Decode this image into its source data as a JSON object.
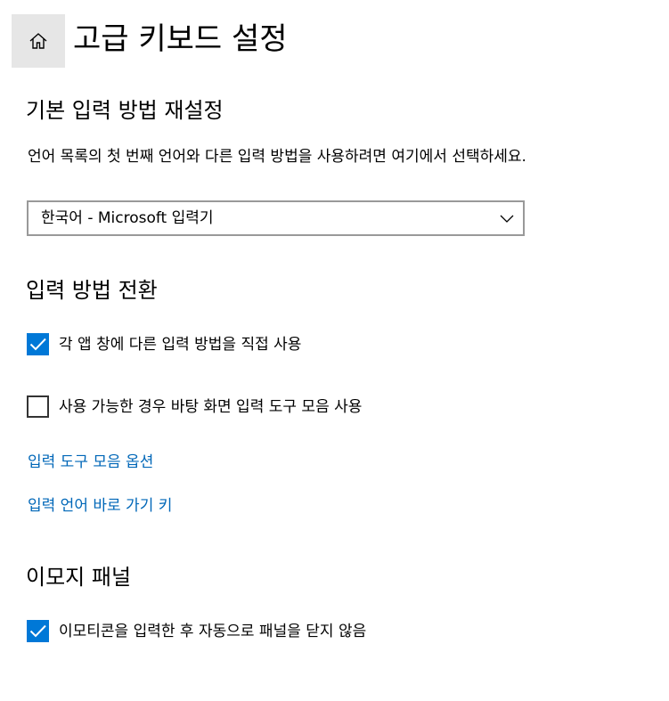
{
  "header": {
    "home_icon": "home-icon",
    "title": "고급 키보드 설정"
  },
  "default_input": {
    "title": "기본 입력 방법 재설정",
    "description": "언어 목록의 첫 번째 언어와 다른 입력 방법을 사용하려면 여기에서 선택하세요.",
    "dropdown_value": "한국어 - Microsoft 입력기",
    "dropdown_icon": "chevron-down-icon"
  },
  "input_switch": {
    "title": "입력 방법 전환",
    "checkbox_per_app": {
      "label": "각 앱 창에 다른 입력 방법을 직접 사용",
      "checked": true
    },
    "checkbox_desktop_toolbar": {
      "label": "사용 가능한 경우 바탕 화면 입력 도구 모음 사용",
      "checked": false
    },
    "link_toolbar_options": "입력 도구 모음 옵션",
    "link_hotkeys": "입력 언어 바로 가기 키"
  },
  "emoji_panel": {
    "title": "이모지 패널",
    "checkbox_auto_close": {
      "label": "이모티콘을 입력한 후 자동으로 패널을 닫지 않음",
      "checked": true
    }
  },
  "colors": {
    "accent": "#0078d7",
    "link": "#0067b8",
    "home_bg": "#e6e6e6",
    "dropdown_border": "#999999"
  }
}
